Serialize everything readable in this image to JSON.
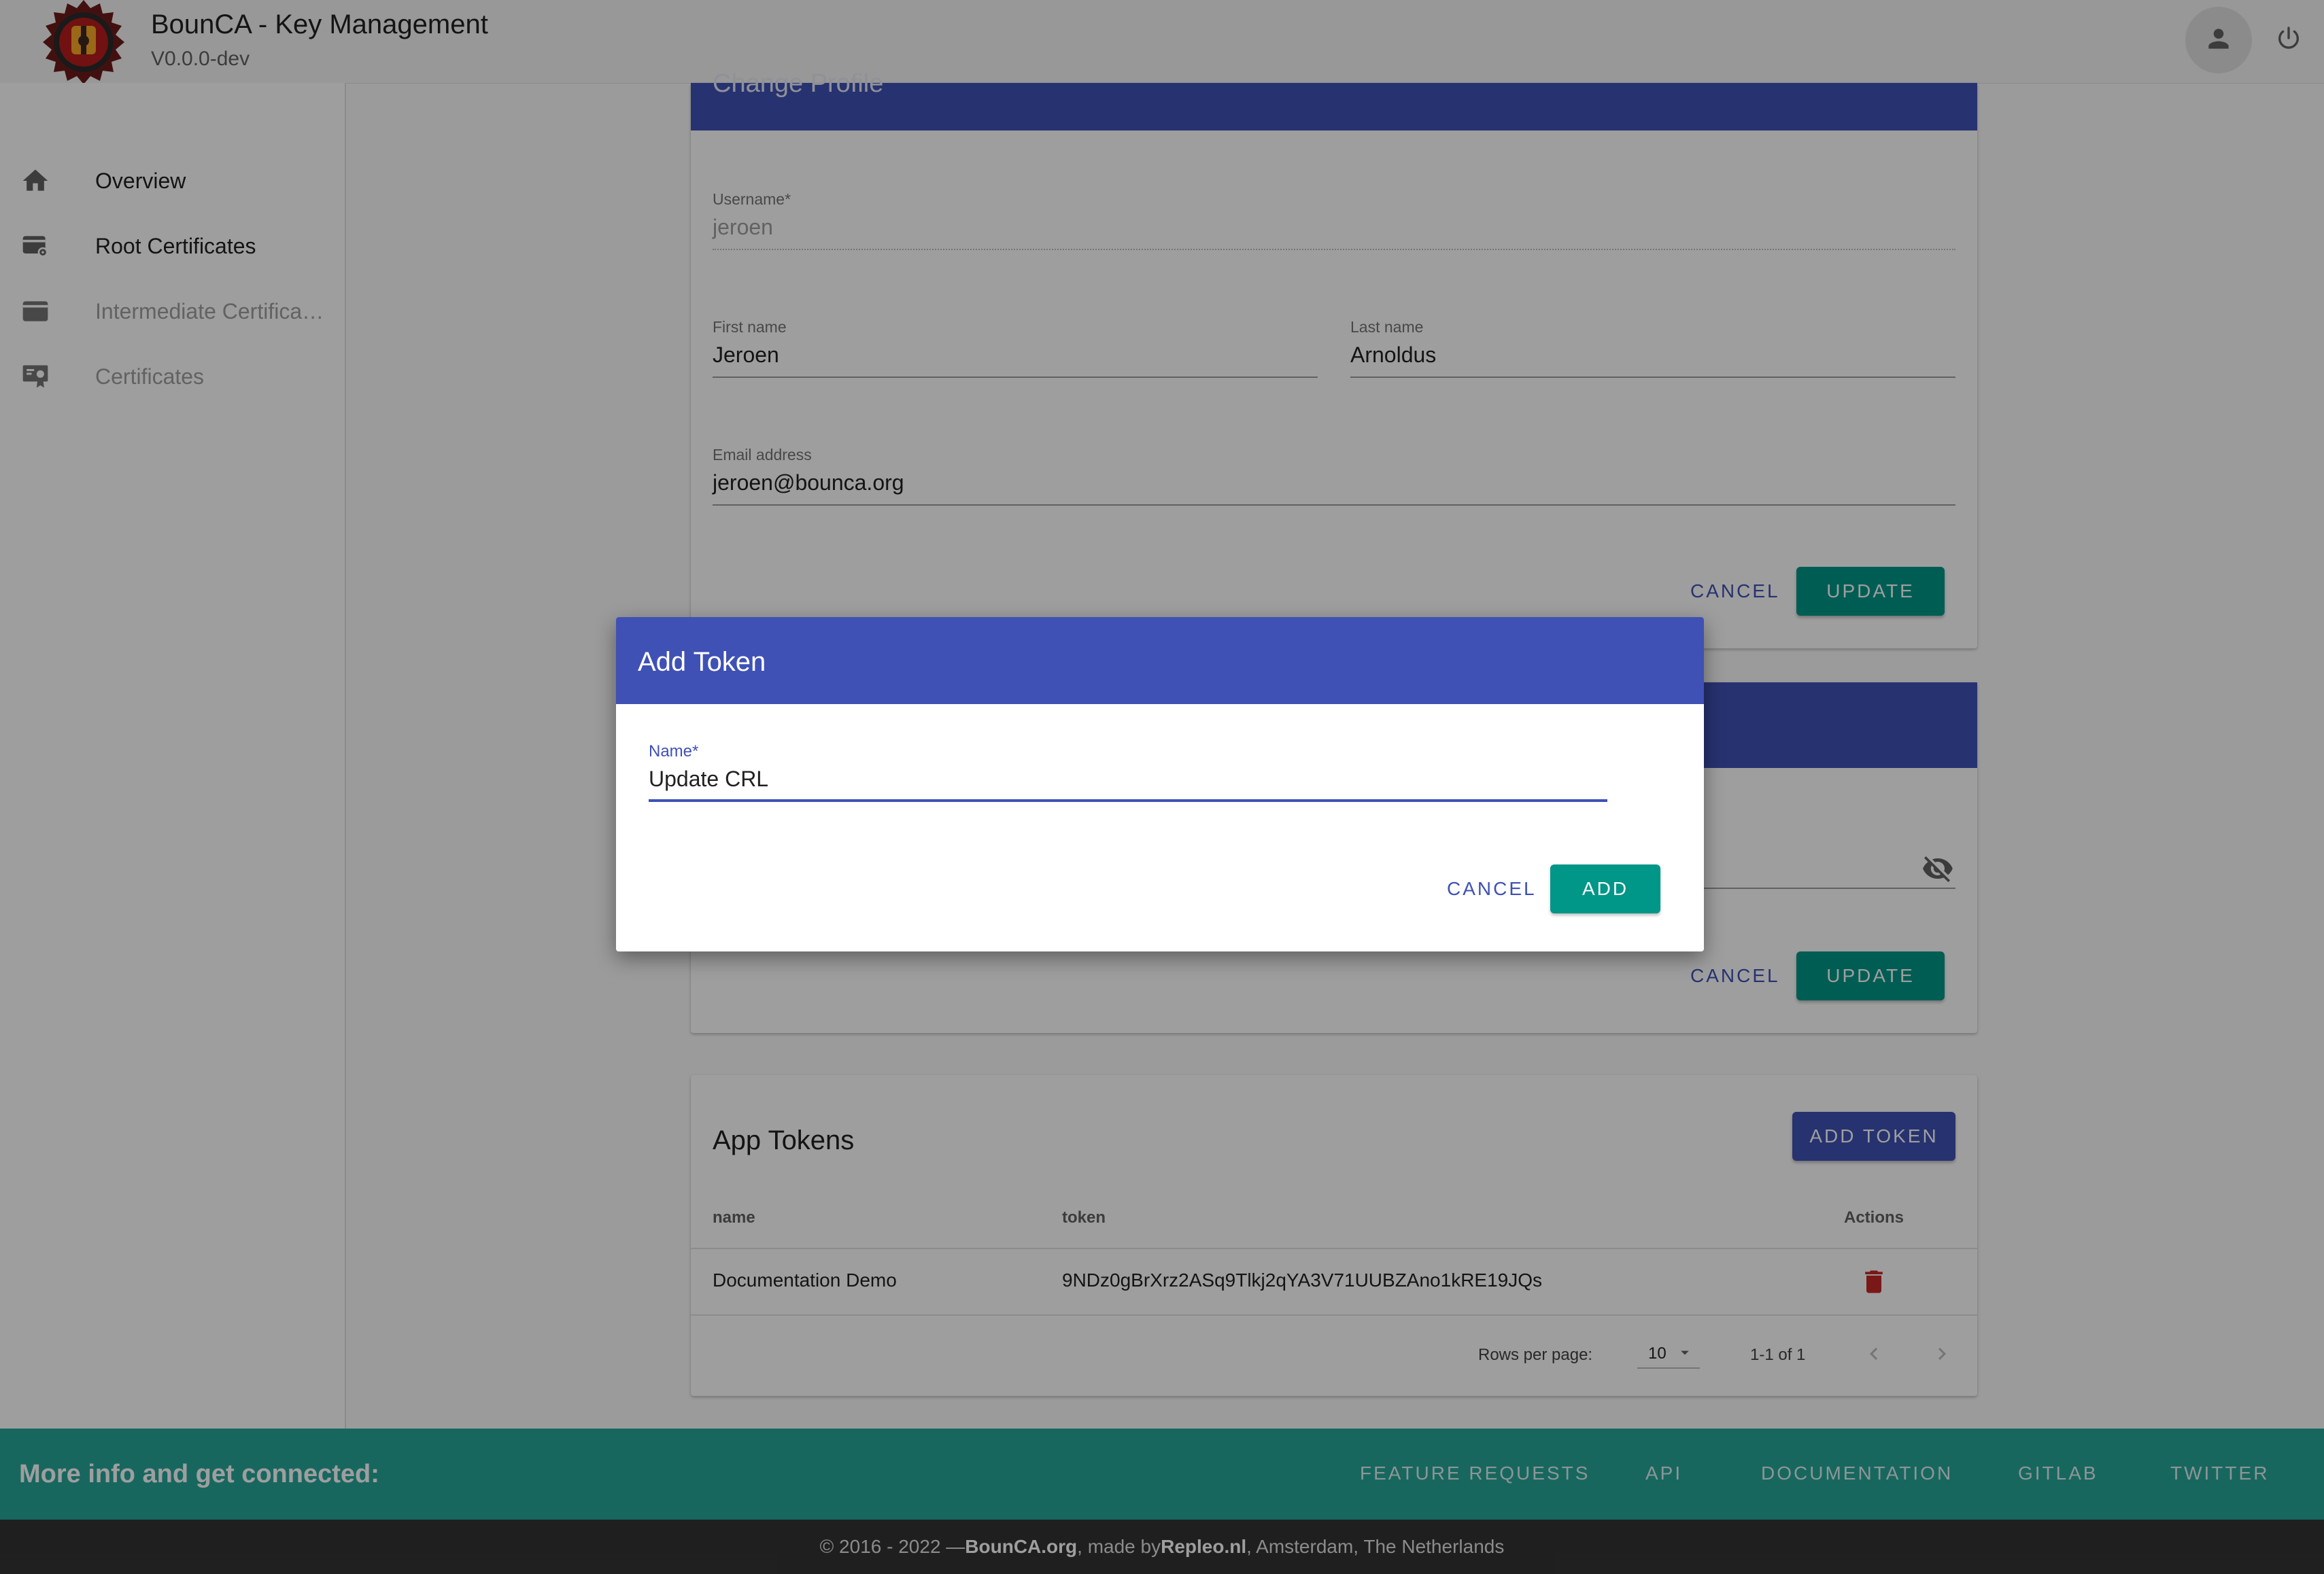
{
  "header": {
    "title": "BounCA - Key Management",
    "version": "V0.0.0-dev"
  },
  "sidebar": {
    "items": [
      {
        "label": "Overview",
        "icon": "home-icon",
        "enabled": true
      },
      {
        "label": "Root Certificates",
        "icon": "root-certificate-icon",
        "enabled": true
      },
      {
        "label": "Intermediate Certificates",
        "icon": "intermediate-certificate-icon",
        "enabled": false
      },
      {
        "label": "Certificates",
        "icon": "certificate-icon",
        "enabled": false
      }
    ]
  },
  "profile": {
    "title": "Change Profile",
    "username_label": "Username*",
    "username": "jeroen",
    "first_name_label": "First name",
    "first_name": "Jeroen",
    "last_name_label": "Last name",
    "last_name": "Arnoldus",
    "email_label": "Email address",
    "email": "jeroen@bounca.org",
    "cancel": "CANCEL",
    "update": "UPDATE"
  },
  "password": {
    "cancel": "CANCEL",
    "update": "UPDATE"
  },
  "tokens": {
    "title": "App Tokens",
    "add_button": "ADD TOKEN",
    "columns": [
      "name",
      "token",
      "Actions"
    ],
    "rows": [
      {
        "name": "Documentation Demo",
        "token": "9NDz0gBrXrz2ASq9Tlkj2qYA3V71UUBZAno1kRE19JQs"
      }
    ],
    "rows_per_page_label": "Rows per page:",
    "rows_per_page": "10",
    "range": "1-1 of 1"
  },
  "footer": {
    "tagline": "More info and get connected:",
    "links": [
      "FEATURE REQUESTS",
      "API",
      "DOCUMENTATION",
      "GITLAB",
      "TWITTER"
    ],
    "copy_prefix": "© 2016 - 2022 — ",
    "brand": "BounCA.org",
    "made_by": ", made by ",
    "maker": "Repleo.nl",
    "location": ", Amsterdam, The Netherlands"
  },
  "dialog": {
    "title": "Add Token",
    "name_label": "Name*",
    "name_value": "Update CRL",
    "cancel": "CANCEL",
    "add": "ADD"
  },
  "colors": {
    "primary": "#3f51b5",
    "teal": "#009688",
    "footer": "#26a69a",
    "delete": "#c62828"
  }
}
